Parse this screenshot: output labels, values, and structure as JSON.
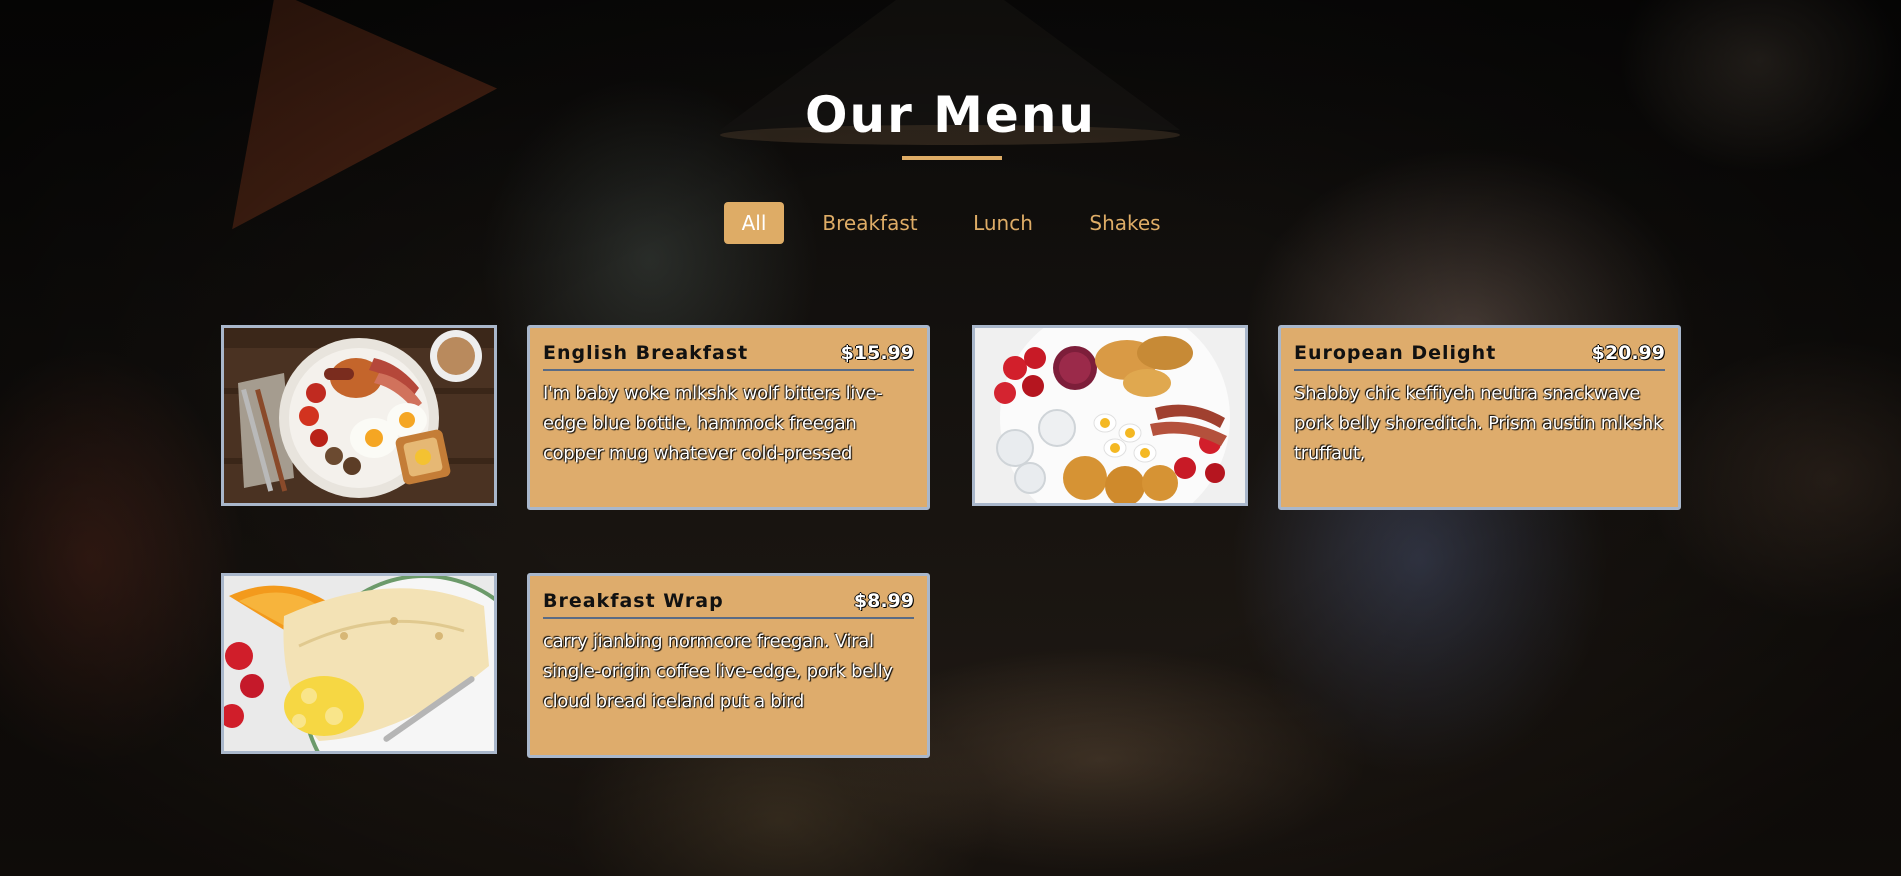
{
  "page": {
    "title": "Our Menu"
  },
  "filters": [
    {
      "label": "All",
      "active": true
    },
    {
      "label": "Breakfast",
      "active": false
    },
    {
      "label": "Lunch",
      "active": false
    },
    {
      "label": "Shakes",
      "active": false
    }
  ],
  "menu": {
    "items": [
      {
        "name": "English Breakfast",
        "price": "$15.99",
        "description": "I'm baby woke mlkshk wolf bitters live-edge blue bottle, hammock freegan copper mug whatever cold-pressed"
      },
      {
        "name": "European Delight",
        "price": "$20.99",
        "description": "Shabby chic keffiyeh neutra snackwave pork belly shoreditch. Prism austin mlkshk truffaut,"
      },
      {
        "name": "Breakfast Wrap",
        "price": "$8.99",
        "description": "carry jianbing normcore freegan. Viral single-origin coffee live-edge, pork belly cloud bread iceland put a bird"
      }
    ]
  },
  "colors": {
    "accent": "#deac66",
    "card_background": "#deac6c",
    "card_border": "#a9b7cb",
    "divider": "#5a6b84"
  },
  "icons": {
    "item_1_image": "english-breakfast-photo",
    "item_2_image": "european-delight-photo",
    "item_3_image": "breakfast-wrap-photo"
  }
}
